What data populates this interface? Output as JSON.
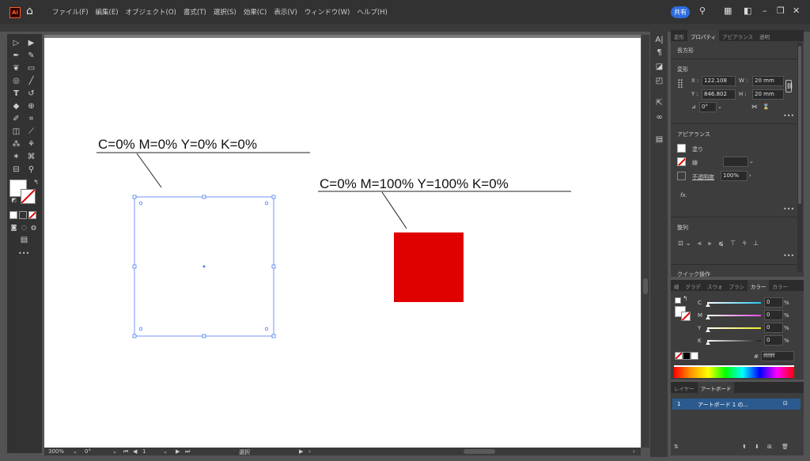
{
  "menubar": {
    "logo": "Ai",
    "menus": [
      "ファイル(F)",
      "編集(E)",
      "オブジェクト(O)",
      "書式(T)",
      "選択(S)",
      "効果(C)",
      "表示(V)",
      "ウィンドウ(W)",
      "ヘルプ(H)"
    ],
    "share_label": "共有"
  },
  "canvas": {
    "label_left": "C=0% M=0% Y=0% K=0%",
    "label_right": "C=0% M=100% Y=100% K=0%",
    "white_square_fill": "#ffffff",
    "red_square_fill": "#e10000",
    "selection_color": "#4f7cf0"
  },
  "statusbar": {
    "zoom": "300%",
    "rotation": "0°",
    "artboard_num": "1",
    "tool": "選択"
  },
  "props_panel": {
    "tabs": [
      "変形",
      "プロパティ",
      "アピアランス",
      "透明"
    ],
    "active_tab": "プロパティ",
    "object_type": "長方形",
    "transform_title": "変形",
    "x_label": "X :",
    "x_value": "122.108",
    "y_label": "Y :",
    "y_value": "846.802",
    "w_label": "W :",
    "w_value": "20 mm",
    "h_label": "H :",
    "h_value": "20 mm",
    "angle_value": "0°",
    "appearance_title": "アピアランス",
    "fill_label": "塗り",
    "stroke_label": "線",
    "opacity_label": "不透明度",
    "opacity_value": "100%",
    "fx_label": "fx.",
    "align_title": "整列",
    "quick_actions_title": "クイック操作"
  },
  "color_panel": {
    "tabs": [
      "線",
      "グラデ",
      "スウォ",
      "ブラシ",
      "カラー",
      "カラー"
    ],
    "active_tab": "カラー",
    "channels": [
      {
        "name": "C",
        "value": "0",
        "unit": "%",
        "color": "#25c6ee"
      },
      {
        "name": "M",
        "value": "0",
        "unit": "%",
        "color": "#e04be0"
      },
      {
        "name": "Y",
        "value": "0",
        "unit": "%",
        "color": "#ecec20"
      },
      {
        "name": "K",
        "value": "0",
        "unit": "%",
        "color": "#222222"
      }
    ],
    "hex_label": "#",
    "hex_value": "ffffff"
  },
  "layers_panel": {
    "tabs": [
      "レイヤー",
      "アートボード"
    ],
    "active_tab": "アートボード",
    "row_num": "1",
    "row_name": "アートボード 1 の..."
  }
}
